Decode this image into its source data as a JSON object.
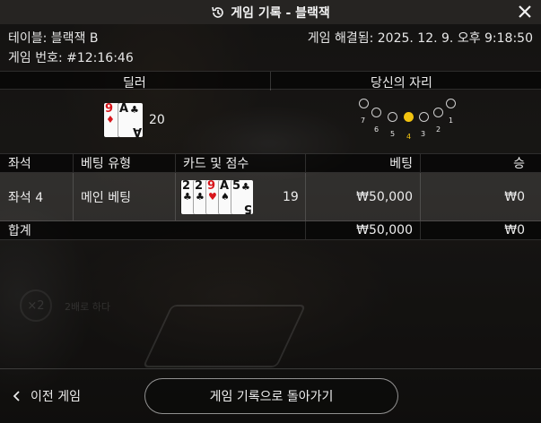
{
  "window": {
    "title": "게임 기록 - 블랙잭"
  },
  "info": {
    "table_label": "테이블: 블랙잭 B",
    "game_number_label": "게임 번호: #12:16:46",
    "resolved_label": "게임 해결됨: 2025. 12. 9. 오후 9:18:50"
  },
  "sections": {
    "dealer": "딜러",
    "your_seat": "당신의 자리"
  },
  "dealer": {
    "cards": [
      {
        "rank": "9",
        "suit": "♦",
        "color": "red"
      },
      {
        "rank": "A",
        "suit": "♣",
        "color": "black"
      }
    ],
    "score": "20"
  },
  "seats": {
    "labels": [
      "7",
      "6",
      "5",
      "4",
      "3",
      "2",
      "1"
    ],
    "active": "4",
    "active_color": "#f3c410"
  },
  "table": {
    "headers": {
      "seat": "좌석",
      "bet_type": "베팅 유형",
      "cards_score": "카드 및 점수",
      "bet": "베팅",
      "win": "승"
    },
    "row": {
      "seat": "좌석 4",
      "bet_type": "메인 베팅",
      "cards": [
        {
          "rank": "2",
          "suit": "♣",
          "color": "black"
        },
        {
          "rank": "2",
          "suit": "♣",
          "color": "black"
        },
        {
          "rank": "9",
          "suit": "♥",
          "color": "red"
        },
        {
          "rank": "A",
          "suit": "♠",
          "color": "black"
        },
        {
          "rank": "5",
          "suit": "♣",
          "color": "black"
        }
      ],
      "score": "19",
      "bet": "₩50,000",
      "win": "₩0"
    },
    "total": {
      "label": "합계",
      "bet": "₩50,000",
      "win": "₩0"
    }
  },
  "background": {
    "multiplier": "×2",
    "multiplier_label": "2배로 하다"
  },
  "footer": {
    "prev_label": "이전 게임",
    "back_label": "게임 기록으로 돌아가기"
  }
}
